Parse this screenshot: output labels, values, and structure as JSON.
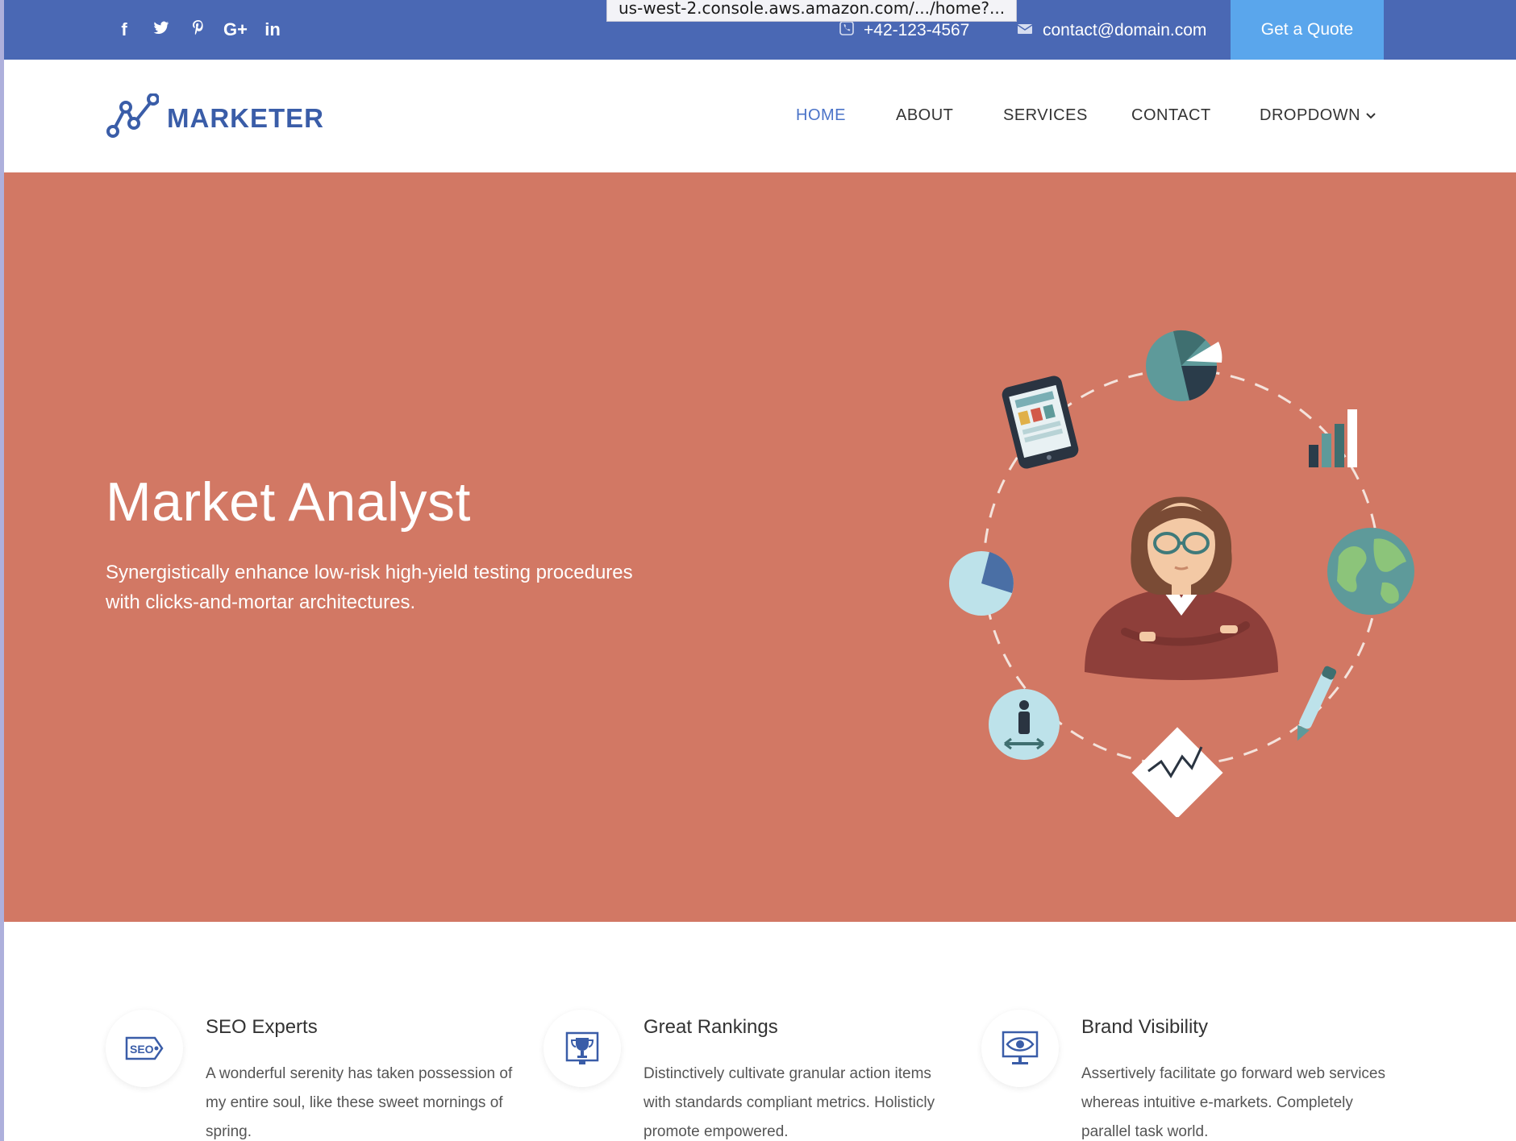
{
  "browser": {
    "url_tooltip": "us-west-2.console.aws.amazon.com/.../home?..."
  },
  "topbar": {
    "social_icons": [
      "facebook-icon",
      "twitter-icon",
      "pinterest-icon",
      "google-plus-icon",
      "linkedin-icon"
    ],
    "social_glyphs": [
      "f",
      "t",
      "p",
      "G+",
      "in"
    ],
    "phone": "+42-123-4567",
    "email": "contact@domain.com",
    "quote_button": "Get a Quote"
  },
  "brand": {
    "name": "MARKETER"
  },
  "nav": {
    "items": [
      "HOME",
      "ABOUT",
      "SERVICES",
      "CONTACT",
      "DROPDOWN"
    ],
    "active": "HOME"
  },
  "hero": {
    "title": "Market Analyst",
    "subtitle": "Synergistically enhance low-risk high-yield testing procedures with clicks-and-mortar architectures."
  },
  "features": [
    {
      "title": "SEO Experts",
      "text": "A wonderful serenity has taken possession of my entire soul, like these sweet mornings of spring.",
      "icon": "seo-tag-icon",
      "icon_label": "SEO"
    },
    {
      "title": "Great Rankings",
      "text": "Distinctively cultivate granular action items with standards compliant metrics. Holisticly promote empowered.",
      "icon": "trophy-icon"
    },
    {
      "title": "Brand Visibility",
      "text": "Assertively facilitate go forward web services whereas intuitive e-markets. Completely parallel task world.",
      "icon": "eye-monitor-icon"
    }
  ],
  "colors": {
    "topbar": "#4a68b4",
    "quote_button": "#5aa6ec",
    "hero": "#d27864",
    "brand": "#3a5da8",
    "nav_active": "#4a73c8"
  }
}
